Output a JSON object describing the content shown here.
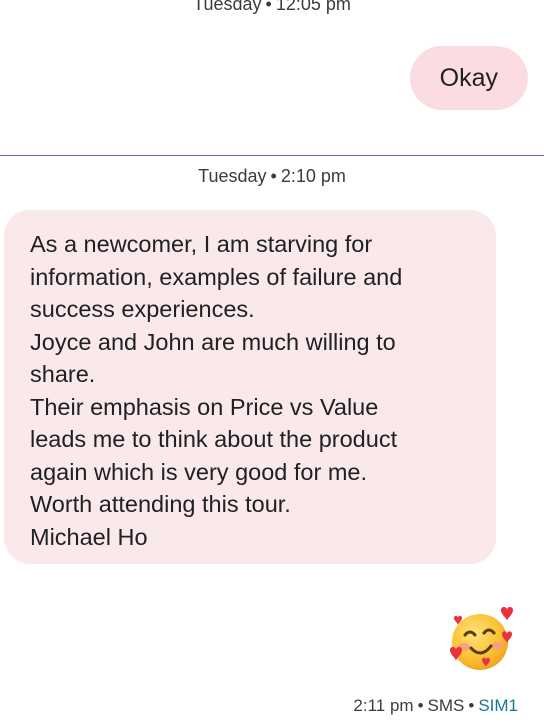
{
  "top_timestamp": {
    "day": "Tuesday",
    "time": "12:05 pm"
  },
  "outgoing_message": {
    "text": "Okay",
    "color": "#fbdde1"
  },
  "divider": {
    "color": "#7d5bd6"
  },
  "mid_timestamp": {
    "day": "Tuesday",
    "time": "2:10 pm"
  },
  "incoming_message": {
    "color": "#fae9ea",
    "lines": [
      "As a newcomer, I am starving for",
      "information, examples of failure and",
      "success experiences.",
      "Joyce and John are much willing to",
      "share.",
      "Their emphasis on Price vs Value",
      "leads me to think about the product",
      "again which is very good for me.",
      "Worth attending this tour.",
      "Michael Ho"
    ]
  },
  "emoji_reply": {
    "icon": "smiling-face-with-hearts-icon"
  },
  "status": {
    "time": "2:11 pm",
    "channel": "SMS",
    "sim": "SIM1",
    "sim_color": "#177a8c"
  }
}
